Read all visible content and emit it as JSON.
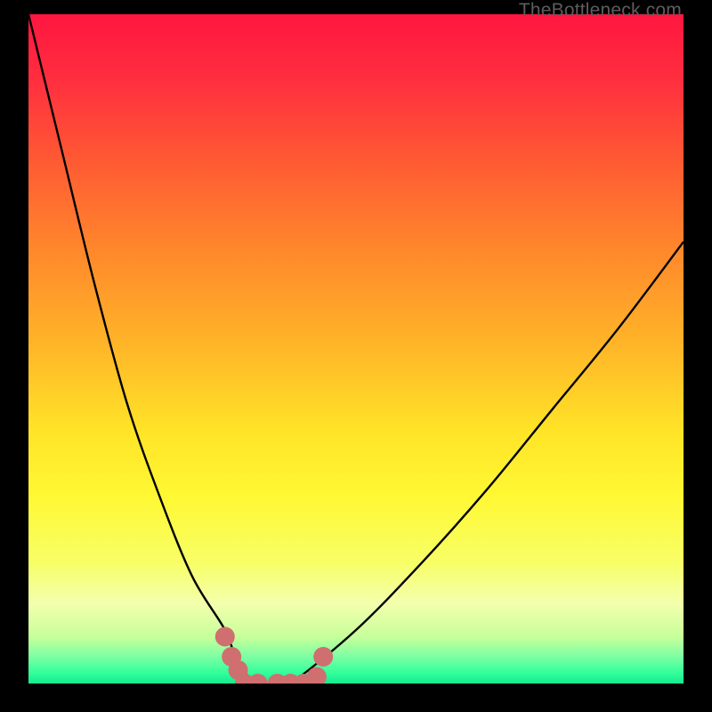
{
  "watermark": "TheBottleneck.com",
  "chart_data": {
    "type": "line",
    "title": "",
    "xlabel": "",
    "ylabel": "",
    "xlim": [
      0,
      100
    ],
    "ylim": [
      0,
      100
    ],
    "grid": false,
    "legend": false,
    "series": [
      {
        "name": "bottleneck-curve",
        "color": "#000000",
        "x": [
          0,
          5,
          10,
          15,
          20,
          25,
          30,
          32,
          35,
          38,
          40,
          50,
          60,
          70,
          80,
          90,
          100
        ],
        "y": [
          100,
          80,
          60,
          42,
          28,
          16,
          8,
          3,
          0,
          0,
          0,
          8,
          18,
          29,
          41,
          53,
          66
        ]
      },
      {
        "name": "curve-valley-marker",
        "color": "#cf6f6f",
        "x": [
          30,
          31,
          32,
          33,
          35,
          38,
          40,
          42,
          44,
          45
        ],
        "y": [
          7,
          4,
          2,
          0,
          0,
          0,
          0,
          0,
          1,
          4
        ]
      }
    ],
    "background_gradient_stops": [
      {
        "offset": 0.0,
        "color": "#ff163f"
      },
      {
        "offset": 0.1,
        "color": "#ff2f3f"
      },
      {
        "offset": 0.22,
        "color": "#ff5a33"
      },
      {
        "offset": 0.36,
        "color": "#ff8a2b"
      },
      {
        "offset": 0.5,
        "color": "#ffb728"
      },
      {
        "offset": 0.62,
        "color": "#ffe327"
      },
      {
        "offset": 0.72,
        "color": "#fff833"
      },
      {
        "offset": 0.82,
        "color": "#f7ff67"
      },
      {
        "offset": 0.88,
        "color": "#f4ffad"
      },
      {
        "offset": 0.93,
        "color": "#c7ff9a"
      },
      {
        "offset": 0.96,
        "color": "#7dffa3"
      },
      {
        "offset": 0.985,
        "color": "#2fff9b"
      },
      {
        "offset": 1.0,
        "color": "#17e88d"
      }
    ]
  }
}
